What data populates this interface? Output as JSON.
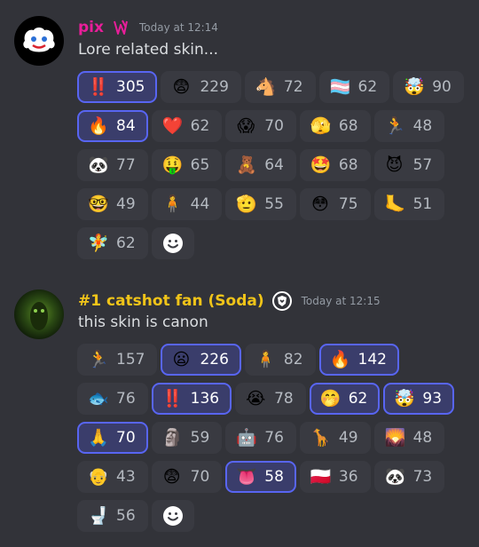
{
  "messages": [
    {
      "username": "pix",
      "username_color": "#e91e9a",
      "timestamp": "Today at 12:14",
      "content": "Lore related skin...",
      "reactions": [
        {
          "emoji": "‼️",
          "icon": "double-exclamation-icon",
          "count": "305",
          "active": true
        },
        {
          "emoji": "😨",
          "icon": "fearful-face-icon",
          "count": "229",
          "active": false
        },
        {
          "emoji": "🐴",
          "icon": "horse-head-icon",
          "count": "72",
          "active": false
        },
        {
          "emoji": "🏳️‍⚧️",
          "icon": "transgender-flag-icon",
          "count": "62",
          "active": false
        },
        {
          "emoji": "🤯",
          "icon": "mind-blown-icon",
          "count": "90",
          "active": false
        },
        {
          "emoji": "🔥",
          "icon": "fire-icon",
          "count": "84",
          "active": true
        },
        {
          "emoji": "❤️",
          "icon": "red-heart-icon",
          "count": "62",
          "active": false
        },
        {
          "emoji": "😱",
          "icon": "custom-screaming-face-icon",
          "count": "70",
          "active": false
        },
        {
          "emoji": "🫣",
          "icon": "peeking-face-icon",
          "count": "68",
          "active": false
        },
        {
          "emoji": "🏃",
          "icon": "custom-running-figure-icon",
          "count": "48",
          "active": false
        },
        {
          "emoji": "🐼",
          "icon": "custom-panda-face-icon",
          "count": "77",
          "active": false
        },
        {
          "emoji": "🤑",
          "icon": "money-mouth-face-icon",
          "count": "65",
          "active": false
        },
        {
          "emoji": "🧸",
          "icon": "custom-character-sprite-icon",
          "count": "64",
          "active": false
        },
        {
          "emoji": "🤩",
          "icon": "star-struck-icon",
          "count": "68",
          "active": false
        },
        {
          "emoji": "😈",
          "icon": "smiling-devil-icon",
          "count": "57",
          "active": false
        },
        {
          "emoji": "🤓",
          "icon": "nerd-face-icon",
          "count": "49",
          "active": false
        },
        {
          "emoji": "🧍",
          "icon": "custom-standing-figure-icon",
          "count": "44",
          "active": false
        },
        {
          "emoji": "🫡",
          "icon": "saluting-face-icon",
          "count": "55",
          "active": false
        },
        {
          "emoji": "😳",
          "icon": "custom-wide-eyes-icon",
          "count": "75",
          "active": false
        },
        {
          "emoji": "🦶",
          "icon": "foot-icon",
          "count": "51",
          "active": false
        },
        {
          "emoji": "🧚",
          "icon": "custom-pink-character-icon",
          "count": "62",
          "active": false
        }
      ]
    },
    {
      "username": "#1 catshot fan (Soda)",
      "username_color": "#f0c419",
      "timestamp": "Today at 12:15",
      "content": "this skin is canon",
      "reactions": [
        {
          "emoji": "🏃",
          "icon": "custom-running-figure-icon",
          "count": "157",
          "active": false
        },
        {
          "emoji": "😦",
          "icon": "frowning-open-mouth-icon",
          "count": "226",
          "active": true
        },
        {
          "emoji": "🧍",
          "icon": "custom-standing-figure-icon",
          "count": "82",
          "active": false
        },
        {
          "emoji": "🔥",
          "icon": "fire-icon",
          "count": "142",
          "active": true
        },
        {
          "emoji": "🐟",
          "icon": "custom-fish-icon",
          "count": "76",
          "active": false
        },
        {
          "emoji": "‼️",
          "icon": "double-exclamation-icon",
          "count": "136",
          "active": true
        },
        {
          "emoji": "😭",
          "icon": "loudly-crying-face-icon",
          "count": "78",
          "active": false
        },
        {
          "emoji": "🤭",
          "icon": "hand-over-mouth-icon",
          "count": "62",
          "active": true
        },
        {
          "emoji": "🤯",
          "icon": "mind-blown-icon",
          "count": "93",
          "active": true
        },
        {
          "emoji": "🙏",
          "icon": "folded-hands-icon",
          "count": "70",
          "active": true
        },
        {
          "emoji": "🗿",
          "icon": "moai-icon",
          "count": "59",
          "active": false
        },
        {
          "emoji": "🤖",
          "icon": "custom-blue-character-icon",
          "count": "76",
          "active": false
        },
        {
          "emoji": "🦒",
          "icon": "giraffe-icon",
          "count": "49",
          "active": false
        },
        {
          "emoji": "🌄",
          "icon": "custom-scene-image-icon",
          "count": "48",
          "active": false
        },
        {
          "emoji": "👴",
          "icon": "older-man-icon",
          "count": "43",
          "active": false
        },
        {
          "emoji": "😨",
          "icon": "fearful-face-icon",
          "count": "70",
          "active": false
        },
        {
          "emoji": "👅",
          "icon": "custom-tongue-mouth-icon",
          "count": "58",
          "active": true
        },
        {
          "emoji": "🇵🇱",
          "icon": "flag-poland-icon",
          "count": "36",
          "active": false
        },
        {
          "emoji": "🐼",
          "icon": "custom-panda-face-icon",
          "count": "73",
          "active": false
        },
        {
          "emoji": "🚽",
          "icon": "toilet-icon",
          "count": "56",
          "active": false
        }
      ]
    }
  ],
  "icons": {
    "add_reaction": "add-reaction-smiley-icon",
    "pix_badge": "pink-role-badge-icon",
    "soda_badge": "circled-shield-badge-icon"
  },
  "colors": {
    "background": "#323339",
    "reaction_bg": "#393a41",
    "reaction_active_bg": "#3a3d6b",
    "reaction_active_border": "#5865f2",
    "text": "#dbdee1",
    "muted": "#949ba4"
  }
}
